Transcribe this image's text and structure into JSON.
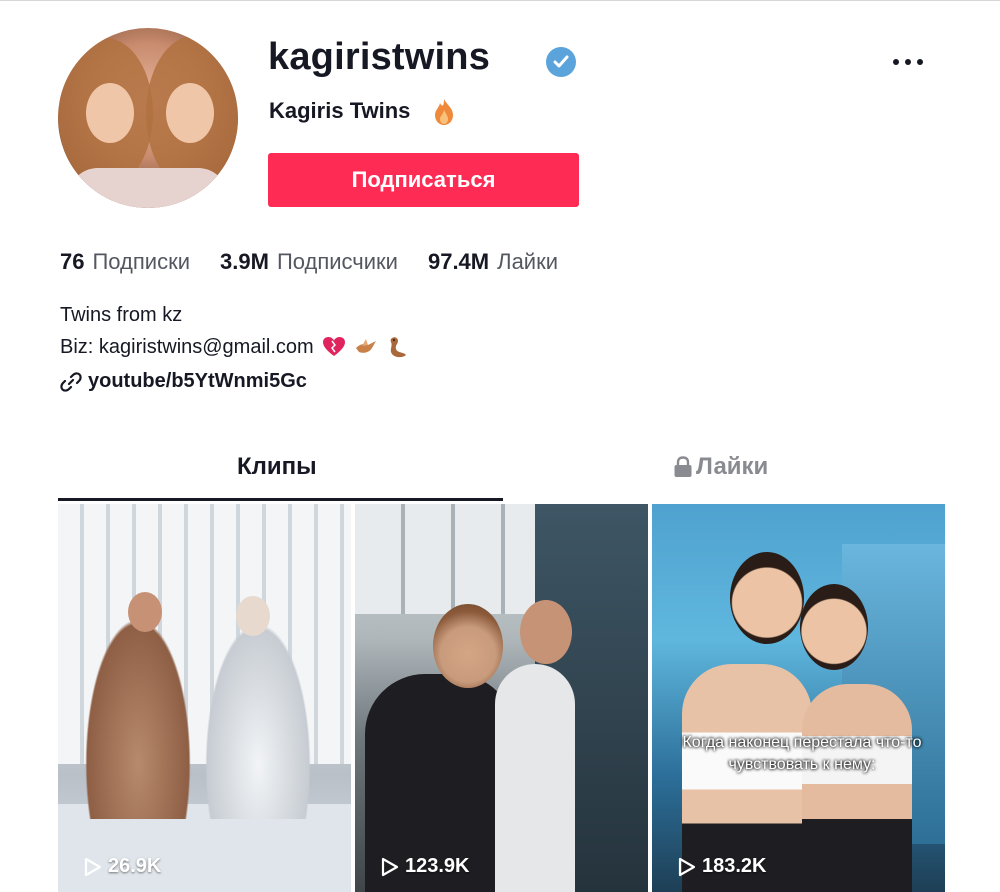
{
  "profile": {
    "username": "kagiristwins",
    "nickname": "Kagiris Twins",
    "follow_label": "Подписаться",
    "verified": true
  },
  "stats": [
    {
      "value": "76",
      "label": "Подписки"
    },
    {
      "value": "3.9M",
      "label": "Подписчики"
    },
    {
      "value": "97.4M",
      "label": "Лайки"
    }
  ],
  "bio": {
    "line1": "Twins from kz",
    "line2": "Biz: kagiristwins@gmail.com",
    "link": "youtube/b5YtWnmi5Gc"
  },
  "tabs": {
    "clips": "Клипы",
    "likes": "Лайки"
  },
  "videos": [
    {
      "views": "26.9K",
      "caption": ""
    },
    {
      "views": "123.9K",
      "caption": ""
    },
    {
      "views": "183.2K",
      "caption": "Когда наконец перестала что-то чувствовать к нему:"
    }
  ],
  "colors": {
    "accent": "#fe2c55",
    "verified": "#5aa4db",
    "text": "#161823",
    "muted": "#8a8b91"
  }
}
